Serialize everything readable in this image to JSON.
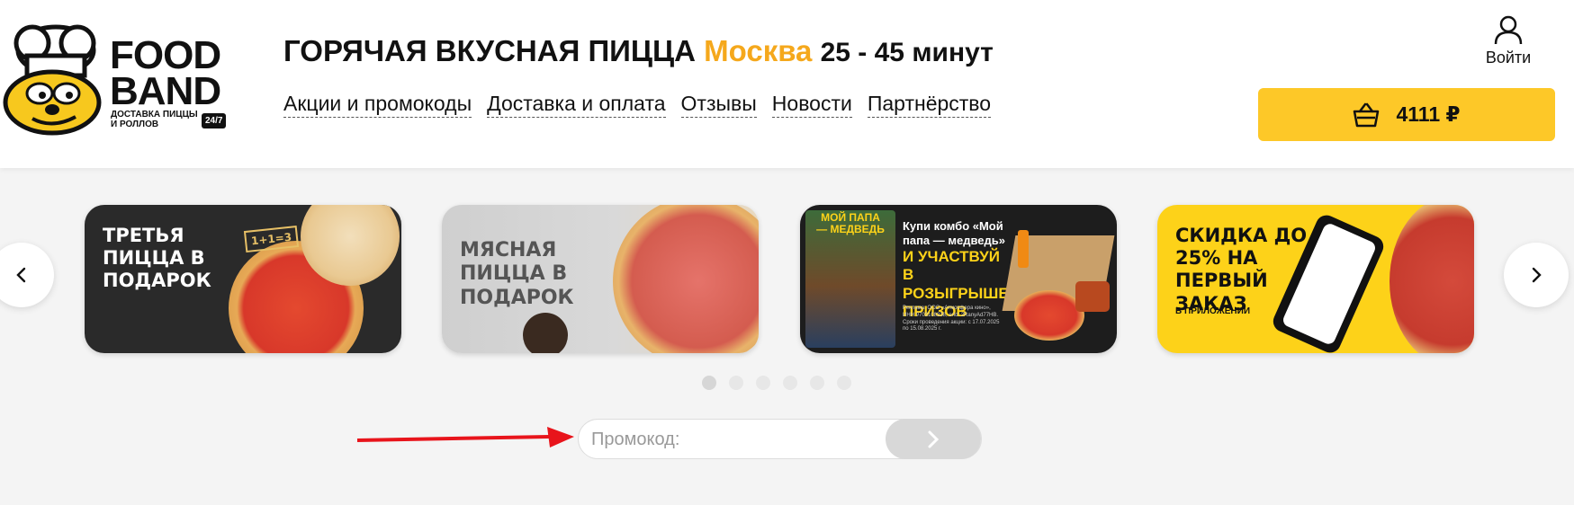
{
  "header": {
    "logo": {
      "line1": "FOOD",
      "line2": "BAND",
      "tagline": "ДОСТАВКА ПИЦЦЫ И РОЛЛОВ",
      "badge": "24/7"
    },
    "headline": {
      "main": "ГОРЯЧАЯ ВКУСНАЯ ПИЦЦА",
      "city": "Москва",
      "time": "25 - 45 минут"
    },
    "nav": [
      {
        "label": "Акции и промокоды"
      },
      {
        "label": "Доставка и оплата"
      },
      {
        "label": "Отзывы"
      },
      {
        "label": "Новости"
      },
      {
        "label": "Партнёрство"
      }
    ],
    "login_label": "Войти",
    "cart_total": "4111 ₽"
  },
  "banners": [
    {
      "text": "ТРЕТЬЯ ПИЦЦА В ПОДАРОК",
      "badge": "1+1=3"
    },
    {
      "text": "МЯСНАЯ ПИЦЦА В ПОДАРОК"
    },
    {
      "poster_title": "МОЙ ПАПА— МЕДВЕДЬ",
      "head": "Купи комбо «Мой папа — медведь»",
      "highlight": "И УЧАСТВУЙ В РОЗЫГРЫШЕ ПРИЗОВ",
      "fine_print": "Реклама: ООО «Атмосфера кино», ИНН 9703108338, erid: 2RanyAd77HB. Сроки проведения акции: с 17.07.2025 по 15.08.2025 г."
    },
    {
      "text": "СКИДКА ДО 25% НА ПЕРВЫЙ ЗАКАЗ",
      "sub": "В ПРИЛОЖЕНИИ"
    }
  ],
  "carousel": {
    "dot_count": 6,
    "active_dot": 1
  },
  "promo": {
    "placeholder": "Промокод:"
  },
  "colors": {
    "accent_yellow": "#fdc828",
    "city_orange": "#f5a81c",
    "annotation_red": "#e8141b"
  }
}
